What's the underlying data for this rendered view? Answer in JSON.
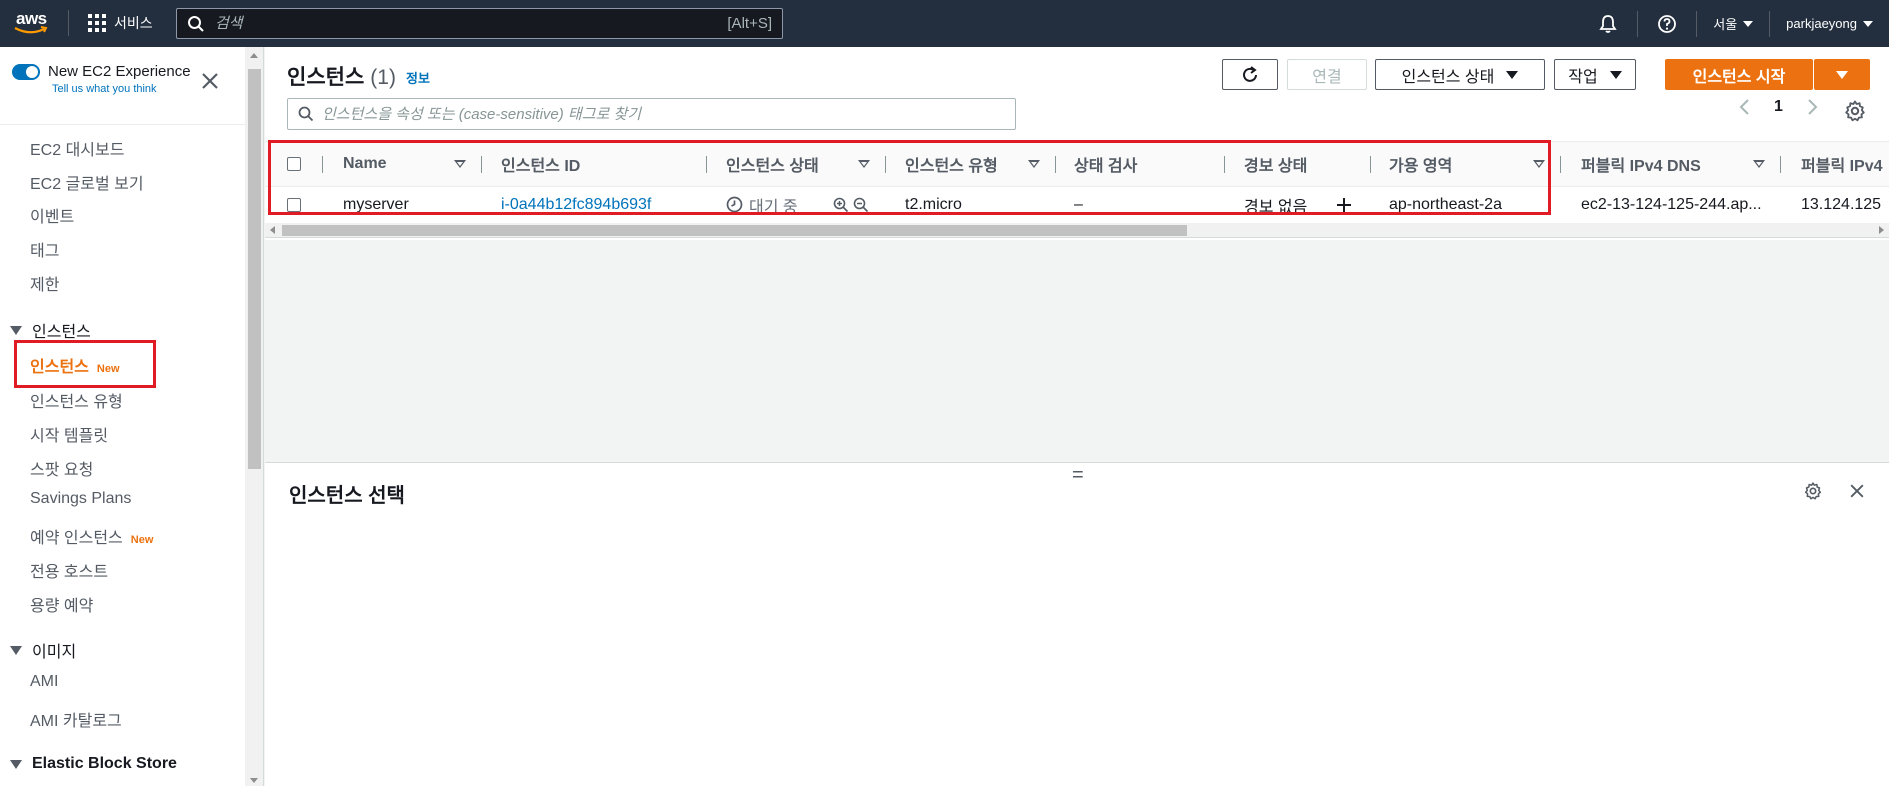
{
  "topnav": {
    "logo": "aws",
    "services_label": "서비스",
    "search_placeholder": "검색",
    "search_shortcut": "[Alt+S]",
    "region": "서울",
    "user": "parkjaeyong"
  },
  "sidebar": {
    "toggle_title": "New EC2 Experience",
    "toggle_subtitle": "Tell us what you think",
    "items_top": [
      "EC2 대시보드",
      "EC2 글로벌 보기",
      "이벤트",
      "태그",
      "제한"
    ],
    "section_instances": "인스턴스",
    "instances_items": [
      "인스턴스",
      "인스턴스 유형",
      "시작 템플릿",
      "스팟 요청",
      "Savings Plans",
      "예약 인스턴스",
      "전용 호스트",
      "용량 예약"
    ],
    "new_badge": "New",
    "section_images": "이미지",
    "images_items": [
      "AMI",
      "AMI 카탈로그"
    ],
    "section_ebs": "Elastic Block Store"
  },
  "main": {
    "title": "인스턴스",
    "count": "(1)",
    "info": "정보",
    "buttons": {
      "connect": "연결",
      "instance_state": "인스턴스 상태",
      "actions": "작업",
      "launch": "인스턴스 시작"
    },
    "filter_placeholder": "인스턴스을 속성 또는 (case-sensitive) 태그로 찾기",
    "page": "1",
    "columns": [
      "Name",
      "인스턴스 ID",
      "인스턴스 상태",
      "인스턴스 유형",
      "상태 검사",
      "경보 상태",
      "가용 영역",
      "퍼블릭 IPv4 DNS",
      "퍼블릭 IPv4"
    ],
    "row": {
      "name": "myserver",
      "instance_id": "i-0a44b12fc894b693f",
      "state": "대기 중",
      "type": "t2.micro",
      "status_check": "–",
      "alarm": "경보 없음",
      "az": "ap-northeast-2a",
      "dns": "ec2-13-124-125-244.ap...",
      "ipv4": "13.124.125"
    },
    "lower_panel_title": "인스턴스 선택",
    "split_handle": "="
  },
  "colors": {
    "nav_bg": "#232f3e",
    "accent_orange": "#ec7211",
    "link_blue": "#0073bb",
    "highlight_red": "#e01b24"
  }
}
